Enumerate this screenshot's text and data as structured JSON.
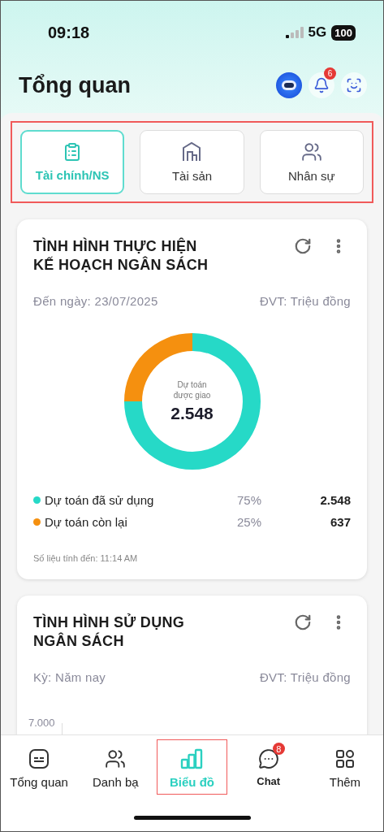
{
  "status_bar": {
    "time": "09:18",
    "network": "5G",
    "battery": "100"
  },
  "header": {
    "title": "Tổng quan",
    "notification_count": "6"
  },
  "tabs_highlighted": true,
  "tabs": [
    {
      "label": "Tài chính/NS",
      "selected": true
    },
    {
      "label": "Tài sản",
      "selected": false
    },
    {
      "label": "Nhân sự",
      "selected": false
    }
  ],
  "budget_card": {
    "title": "TÌNH HÌNH THỰC HIỆN KẾ HOẠCH NGÂN SÁCH",
    "date": "Đến ngày: 23/07/2025",
    "unit": "ĐVT: Triệu đồng",
    "center_label": "Dự toán được giao",
    "center_value": "2.548",
    "chart_data": {
      "type": "donut",
      "categories": [
        "Dự toán đã sử dụng",
        "Dự toán còn lại"
      ],
      "values": [
        75,
        25
      ]
    },
    "legend": [
      {
        "color": "#26d9c7",
        "percent": "75%",
        "value": "2.548"
      },
      {
        "color": "#f5900f",
        "percent": "25%",
        "value": "637"
      }
    ],
    "footnote": "Số liệu tính đến: 11:14 AM"
  },
  "usage_card": {
    "title": "TÌNH HÌNH SỬ DỤNG NGÂN SÁCH",
    "period": "Kỳ: Năm nay",
    "unit": "ĐVT: Triệu đồng",
    "y_axis_label": "7.000"
  },
  "nav": [
    {
      "label": "Tổng quan",
      "selected": false,
      "highlighted": false
    },
    {
      "label": "Danh bạ",
      "selected": false,
      "highlighted": false
    },
    {
      "label": "Biểu đồ",
      "selected": true,
      "highlighted": true
    },
    {
      "label": "Chat",
      "selected": false,
      "highlighted": false,
      "badge": "8"
    },
    {
      "label": "Thêm",
      "selected": false,
      "highlighted": false
    }
  ]
}
